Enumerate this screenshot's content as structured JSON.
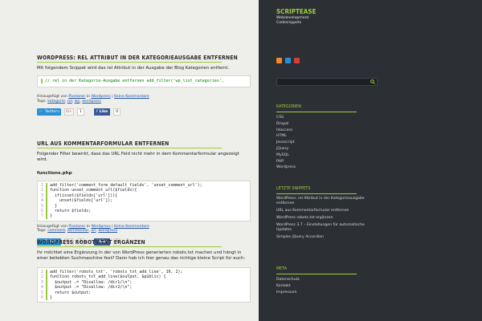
{
  "posts": [
    {
      "title": "Wordpress: rel Attribut in der Kategorieausgabe entfernen",
      "intro": "Mit folgendem Snippet wird das rel Attribut in der Ausgabe der Blog Kategorien entfernt.",
      "code": "// rel in der Kategorie-Ausgabe entfernen add_filter('wp_list_categories',",
      "meta_prefix": "Hinzugefügt von",
      "author": "Pixelaner",
      "meta_in": "in",
      "category": "Wordpress",
      "comments": "Keine Kommentare",
      "tags_label": "Tags:",
      "tags": [
        "kategorie",
        "rel",
        "wp",
        "wordpress"
      ],
      "tweet_label": "Twittern",
      "gplus_count": "1",
      "fb_label": "Like",
      "fb_count": "0"
    },
    {
      "title": "URL aus Kommentarformular entfernen",
      "intro": "Folgender Filter bewirkt, dass das URL Feld nicht mehr in dem Kommentarformular angezeigt wird.",
      "file": "functions.php",
      "code_lines": [
        "add_filter('comment_form_default_fields', 'unset_comment_url');",
        "function unset_comment_url($fields){",
        "  if(isset($fields['url'])){",
        "    unset($fields['url']);",
        "  }",
        "  return $fields;",
        "}"
      ],
      "meta_prefix": "Hinzugefügt von",
      "author": "Pixelaner",
      "meta_in": "in",
      "category": "Wordpress",
      "comments": "Keine Kommentare",
      "tags_label": "Tags:",
      "tags": [
        "comment",
        "kommentar",
        "url",
        "wordpress"
      ],
      "tweet_label": "Twittern",
      "gplus_count": "1",
      "fb_label": "Like",
      "fb_count": "0"
    },
    {
      "title": "Wordpress robots.txt ergänzen",
      "intro": "Ihr möchtet eine Ergänzung in der von WordPress generierten robots.txt machen und hängt in einer beliebten Suchmaschine fest? Dann hab ich hier genau das richtige kleine Script für euch:",
      "code_lines": [
        "add_filter('robots_txt', 'robots_txt_add_line', 10, 2);",
        "function robots_txt_add_line($output, $public) {",
        "  $output .= \"Disallow: /dir1/\\n\";",
        "  $output .= \"Disallow: /dir2/\\n\";",
        "  return $output;",
        "}"
      ]
    }
  ],
  "sidebar": {
    "brand_title": "SCRIPTEASE",
    "brand_sub1": "Webdevelopment",
    "brand_sub2": "Codesnippets",
    "categories_heading": "Kategorien",
    "categories": [
      "CSS",
      "Drupal",
      "htaccess",
      "HTML",
      "Javascript",
      "jQuery",
      "MySQL",
      "PHP",
      "Wordpress"
    ],
    "recent_heading": "Letzte Snippets",
    "recent": [
      "WordPress: rel Attribut in der Kategorieausgabe entfernen",
      "URL aus Kommentarformular entfernen",
      "WordPress robots.txt ergänzen",
      "WordPress 3.7 – Einstellungen für automatische Updates",
      "Simples jQuery Accordion"
    ],
    "meta_heading": "Meta",
    "meta": [
      "Datenschutz",
      "Kontakt",
      "Impressum"
    ]
  },
  "colors": {
    "accent": "#9ccc3c",
    "sidebar_bg": "#2c3035",
    "twitter": "#2a8fd6",
    "facebook": "#3b5998"
  }
}
